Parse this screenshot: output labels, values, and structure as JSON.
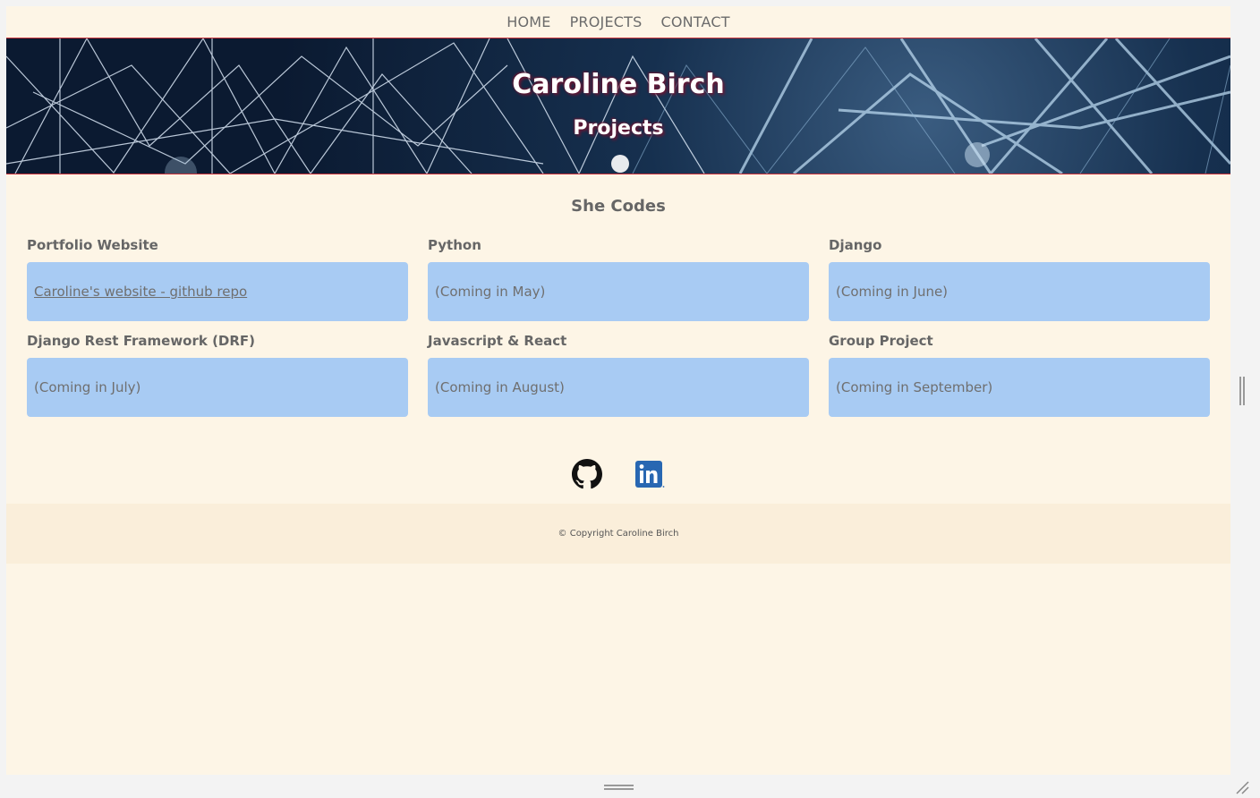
{
  "nav": {
    "items": [
      {
        "label": "HOME"
      },
      {
        "label": "PROJECTS"
      },
      {
        "label": "CONTACT"
      }
    ]
  },
  "hero": {
    "title": "Caroline Birch",
    "subtitle": "Projects"
  },
  "main": {
    "section_title": "She Codes",
    "cards": [
      {
        "label": "Portfolio Website",
        "text": "Caroline's website - github repo",
        "is_link": true
      },
      {
        "label": "Python",
        "text": "(Coming in May)"
      },
      {
        "label": "Django",
        "text": "(Coming in June)"
      },
      {
        "label": "Django Rest Framework (DRF)",
        "text": "(Coming in July)"
      },
      {
        "label": "Javascript & React",
        "text": "(Coming in August)"
      },
      {
        "label": "Group Project",
        "text": "(Coming in September)"
      }
    ]
  },
  "socials": {
    "icons": [
      "github-icon",
      "linkedin-icon"
    ]
  },
  "footer": {
    "text": "© Copyright Caroline Birch"
  },
  "colors": {
    "page_bg": "#fdf5e6",
    "card_bg": "#a8cbf3",
    "footer_bg": "#faeeda",
    "accent_line": "#c8323a",
    "linkedin": "#2867b2"
  }
}
